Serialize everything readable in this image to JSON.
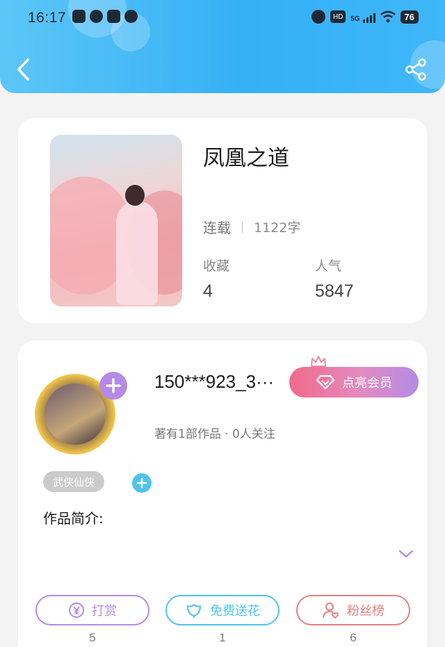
{
  "status_bar": {
    "time": "16:17",
    "network": "5G",
    "hd": "HD",
    "battery": "76"
  },
  "header": {
    "gradient_colors": [
      "#5cc6f7",
      "#35b0f5"
    ]
  },
  "book": {
    "title": "凤凰之道",
    "status": "连载",
    "word_count": "1122字",
    "favorites_label": "收藏",
    "favorites_value": "4",
    "popularity_label": "人气",
    "popularity_value": "5847"
  },
  "author": {
    "name": "150***923_3···",
    "vip_button_label": "点亮会员",
    "meta": "著有1部作品 · 0人关注",
    "genre_tag": "武侠仙侠",
    "intro_label": "作品简介:"
  },
  "actions": [
    {
      "label": "打赏",
      "count": "5",
      "color": "#b48ae6",
      "icon": "yen-coin-icon"
    },
    {
      "label": "免费送花",
      "count": "1",
      "color": "#4fc3ee",
      "icon": "flower-icon"
    },
    {
      "label": "粉丝榜",
      "count": "6",
      "color": "#e7807e",
      "icon": "user-heart-icon"
    }
  ]
}
